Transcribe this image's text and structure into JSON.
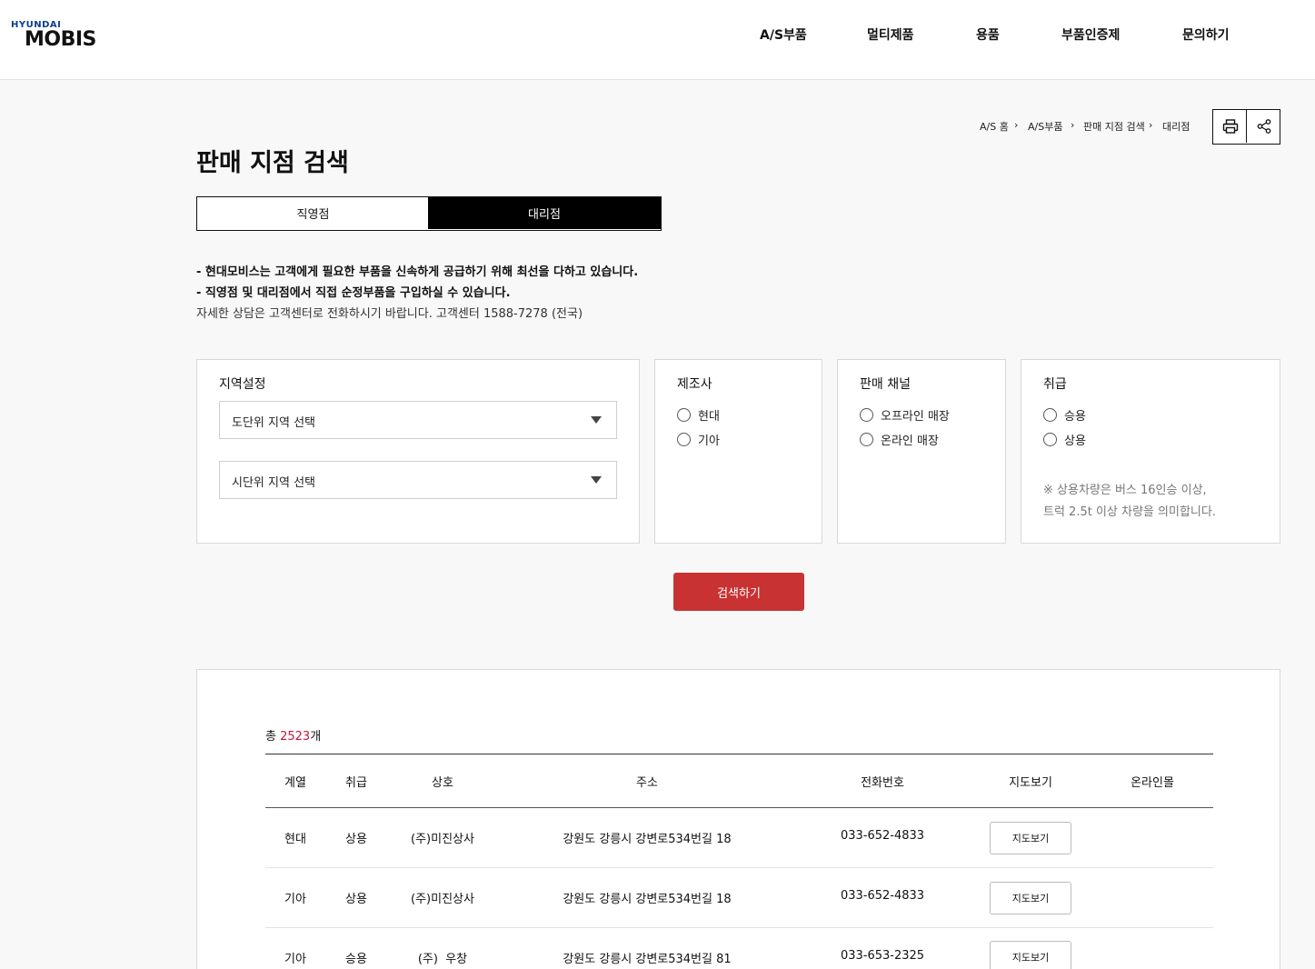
{
  "header": {
    "logo_top": "HYUNDAI",
    "logo_main": "MOBIS",
    "nav": [
      "A/S부품",
      "멀티제품",
      "용품",
      "부품인증제",
      "문의하기"
    ]
  },
  "breadcrumb": [
    "A/S 홈",
    "A/S부품",
    "판매 지점 검색",
    "대리점"
  ],
  "breadcrumb_sep": "›",
  "tools": {
    "print_icon": "printer-icon",
    "share_icon": "share-icon"
  },
  "page_title": "판매 지점 검색",
  "tabs": [
    {
      "label": "직영점",
      "active": false
    },
    {
      "label": "대리점",
      "active": true
    }
  ],
  "notice": {
    "line1": "- 현대모비스는 고객에게 필요한 부품을 신속하게 공급하기 위해 최선을 다하고 있습니다.",
    "line2": "- 직영점 및 대리점에서 직접 순정부품을 구입하실 수 있습니다.",
    "line3": "자세한 상담은 고객센터로 전화하시기 바랍니다. 고객센터 1588-7278 (전국)"
  },
  "filters": {
    "region": {
      "title": "지역설정",
      "province_placeholder": "도단위 지역 선택",
      "city_placeholder": "시단위 지역 선택"
    },
    "maker": {
      "title": "제조사",
      "options": [
        "현대",
        "기아"
      ]
    },
    "channel": {
      "title": "판매 채널",
      "options": [
        "오프라인 매장",
        "온라인 매장"
      ]
    },
    "handling": {
      "title": "취급",
      "options": [
        "승용",
        "상용"
      ],
      "note1": "※ 상용차량은 버스 16인승 이상,",
      "note2": "트럭 2.5t 이상 차량을 의미합니다."
    }
  },
  "search_button": "검색하기",
  "results": {
    "total_prefix": "총 ",
    "total_count": "2523",
    "total_suffix": "개",
    "columns": [
      "계열",
      "취급",
      "상호",
      "주소",
      "전화번호",
      "지도보기",
      "온라인몰"
    ],
    "rows": [
      {
        "brand": "현대",
        "type": "상용",
        "name": "(주)미진상사",
        "address": "강원도 강릉시 강변로534번길 18",
        "phone": "033-652-4833",
        "map_label": "지도보기",
        "online": ""
      },
      {
        "brand": "기아",
        "type": "상용",
        "name": "(주)미진상사",
        "address": "강원도 강릉시 강변로534번길 18",
        "phone": "033-652-4833",
        "map_label": "지도보기",
        "online": ""
      },
      {
        "brand": "기아",
        "type": "승용",
        "name": "(주)  우창",
        "address": "강원도 강릉시 강변로534번길 81",
        "phone": "033-653-2325",
        "map_label": "지도보기",
        "online": ""
      }
    ]
  },
  "colors": {
    "accent_red": "#c83232",
    "count_red": "#c8143c",
    "logo_blue": "#0b3f8c"
  }
}
